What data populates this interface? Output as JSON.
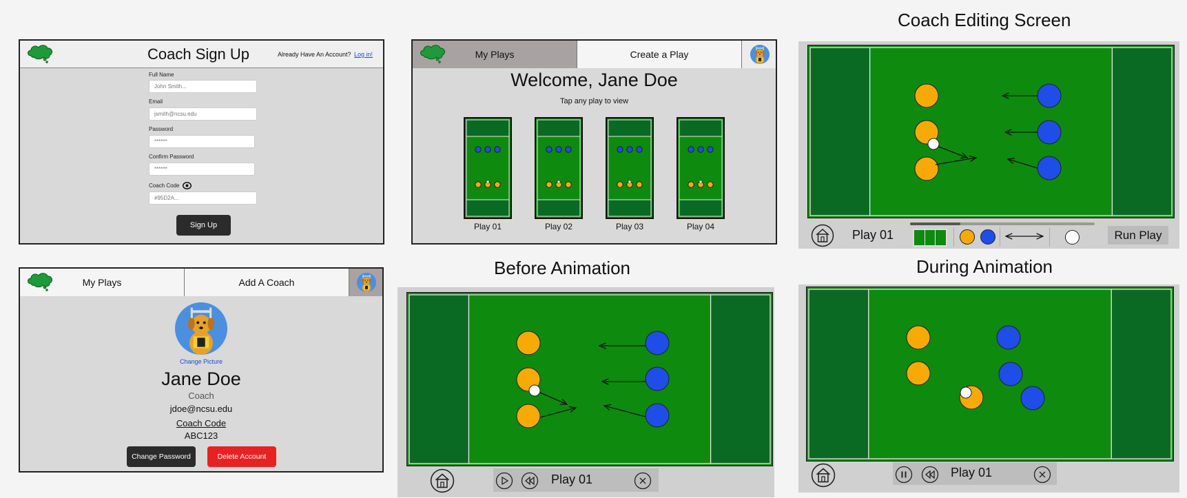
{
  "colors": {
    "field": "#0e8a0e",
    "field_dark": "#0a6a24",
    "orange": "#f7aa06",
    "blue": "#1f4de8",
    "red": "#e82222",
    "dark_button": "#2b2b2b",
    "panel_bg": "#d9d9d9",
    "link": "#1a4dd6"
  },
  "signup": {
    "title": "Coach Sign Up",
    "have_account": "Already Have An Account?",
    "login_link": "Log in!",
    "fields": [
      {
        "label": "Full Name",
        "placeholder": "John Smith..."
      },
      {
        "label": "Email",
        "placeholder": "jsmith@ncsu.edu"
      },
      {
        "label": "Password",
        "placeholder": "******"
      },
      {
        "label": "Confirm Password",
        "placeholder": "******"
      },
      {
        "label": "Coach Code",
        "placeholder": "#95D2A...",
        "icon": "eye-icon"
      }
    ],
    "submit": "Sign Up"
  },
  "myplays": {
    "tabs": [
      "My Plays",
      "Create a Play"
    ],
    "welcome": "Welcome, Jane Doe",
    "subtitle": "Tap any play to view",
    "plays": [
      "Play 01",
      "Play 02",
      "Play 03",
      "Play 04"
    ]
  },
  "profile": {
    "tabs": [
      "My Plays",
      "Add A Coach"
    ],
    "change_picture": "Change Picture",
    "name": "Jane Doe",
    "role": "Coach",
    "email": "jdoe@ncsu.edu",
    "code_label": "Coach Code",
    "code_value": "ABC123",
    "change_password": "Change Password",
    "delete_account": "Delete Account"
  },
  "editing": {
    "title": "Coach Editing Screen",
    "play_name": "Play 01",
    "run_play": "Run Play"
  },
  "before": {
    "title": "Before Animation",
    "play_name": "Play 01"
  },
  "during": {
    "title": "During Animation",
    "play_name": "Play 01"
  }
}
